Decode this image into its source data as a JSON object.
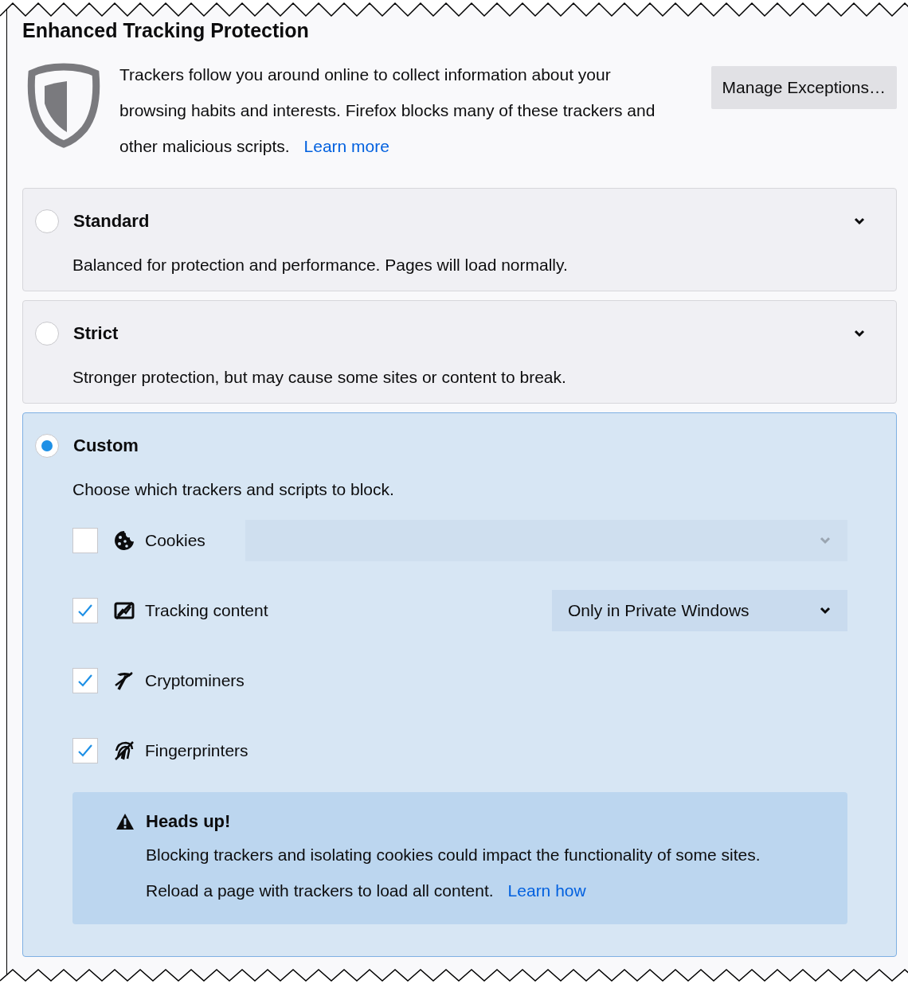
{
  "section": {
    "title": "Enhanced Tracking Protection"
  },
  "intro": {
    "text": "Trackers follow you around online to collect information about your browsing habits and interests. Firefox blocks many of these trackers and other malicious scripts.",
    "link": "Learn more"
  },
  "manage_button": "Manage Exceptions…",
  "options": [
    {
      "title": "Standard",
      "description": "Balanced for protection and performance. Pages will load normally.",
      "selected": false,
      "expanded": false
    },
    {
      "title": "Strict",
      "description": "Stronger protection, but may cause some sites or content to break.",
      "selected": false,
      "expanded": false
    },
    {
      "title": "Custom",
      "description": "Choose which trackers and scripts to block.",
      "selected": true,
      "expanded": true,
      "categories": [
        {
          "kind": "cookies",
          "label": "Cookies",
          "checked": false,
          "dropdown": {
            "disabled": true
          }
        },
        {
          "kind": "tracking",
          "label": "Tracking content",
          "checked": true,
          "dropdown": {
            "disabled": false,
            "value": "Only in Private Windows"
          }
        },
        {
          "kind": "cryptominers",
          "label": "Cryptominers",
          "checked": true
        },
        {
          "kind": "fingerprinters",
          "label": "Fingerprinters",
          "checked": true
        }
      ],
      "warning": {
        "title": "Heads up!",
        "text": "Blocking trackers and isolating cookies could impact the functionality of some sites. Reload a page with trackers to load all content.",
        "link": "Learn how"
      }
    }
  ]
}
